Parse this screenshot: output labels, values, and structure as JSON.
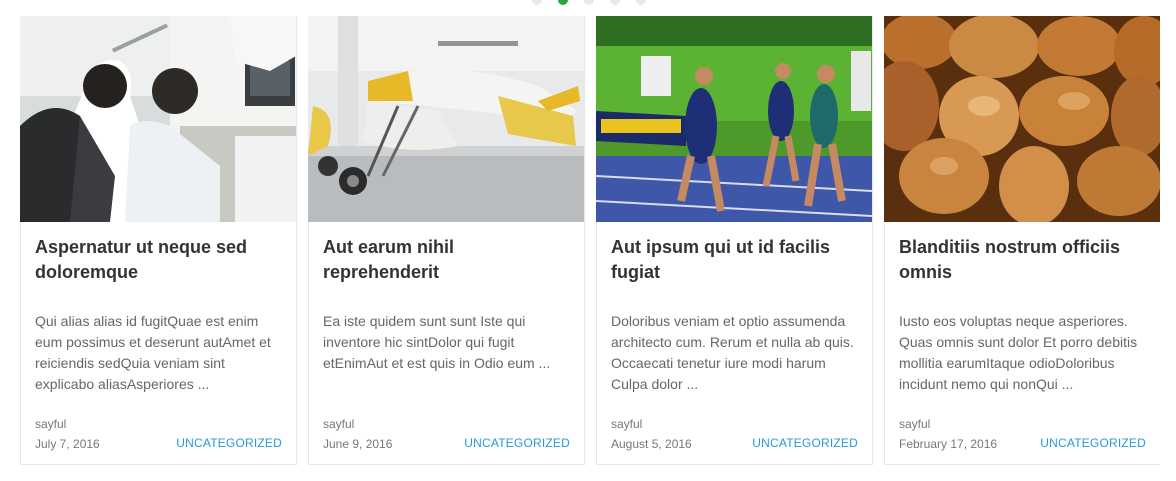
{
  "slider": {
    "dot_count": 5,
    "active_dot_index": 1,
    "colors": {
      "active": "#27a737",
      "inactive": "#e9e9e9",
      "link": "#2a9ad6"
    }
  },
  "posts": [
    {
      "title": "Aspernatur ut neque sed doloremque",
      "excerpt": "Qui alias alias id fugitQuae est enim eum possimus et deserunt autAmet et reiciendis sedQuia veniam sint explicabo aliasAsperiores ...",
      "author": "sayful",
      "date": "July 7, 2016",
      "category": "UNCATEGORIZED",
      "image": "office-workers-photo"
    },
    {
      "title": "Aut earum nihil reprehenderit",
      "excerpt": "Ea iste quidem sunt sunt Iste qui inventore hic sintDolor qui fugit etEnimAut et est quis in Odio eum ...",
      "author": "sayful",
      "date": "June 9, 2016",
      "category": "UNCATEGORIZED",
      "image": "small-airplane-photo"
    },
    {
      "title": "Aut ipsum qui ut id facilis fugiat",
      "excerpt": "Doloribus veniam et optio assumenda architecto cum. Rerum et nulla ab quis. Occaecati tenetur iure modi harum Culpa dolor ...",
      "author": "sayful",
      "date": "August 5, 2016",
      "category": "UNCATEGORIZED",
      "image": "sprinters-race-photo"
    },
    {
      "title": "Blanditiis nostrum officiis omnis",
      "excerpt": "Iusto eos voluptas neque asperiores. Quas omnis sunt dolor Et porro debitis mollitia earumItaque odioDoloribus incidunt nemo qui nonQui ...",
      "author": "sayful",
      "date": "February 17, 2016",
      "category": "UNCATEGORIZED",
      "image": "nuts-closeup-photo"
    }
  ]
}
